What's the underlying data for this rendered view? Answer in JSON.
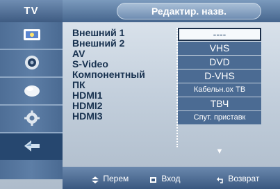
{
  "header": {
    "menu_title": "TV",
    "screen_title": "Редактир. назв."
  },
  "sidebar": {
    "items": [
      {
        "icon": "picture-icon"
      },
      {
        "icon": "sound-icon"
      },
      {
        "icon": "channel-icon"
      },
      {
        "icon": "setup-icon"
      },
      {
        "icon": "input-icon",
        "active": true
      }
    ]
  },
  "sources": [
    "Внешний 1",
    "Внешний 2",
    "AV",
    "S-Video",
    "Компонентный",
    "ПК",
    "HDMI1",
    "HDMI2",
    "HDMI3"
  ],
  "names": [
    "----",
    "VHS",
    "DVD",
    "D-VHS",
    "Кабельн.ох ТВ",
    "ТВЧ",
    "Спут. приставк"
  ],
  "footer": {
    "move": "Перем",
    "enter": "Вход",
    "return": "Возврат"
  },
  "colors": {
    "accent": "#3e5b82",
    "highlight": "#f6f9fc",
    "text_dark": "#17314f"
  }
}
